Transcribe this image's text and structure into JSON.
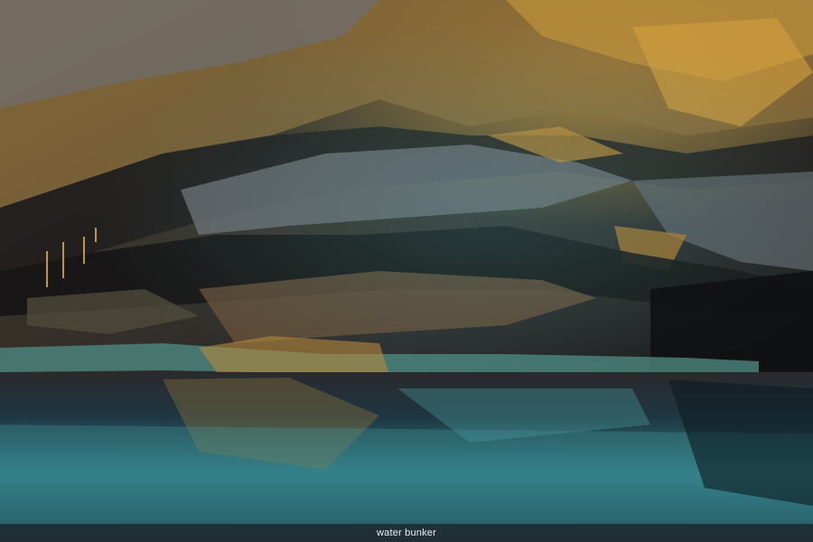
{
  "photo": {
    "subject": "cave-with-reflective-water",
    "colors": {
      "rock_dark": "#1c1a1a",
      "rock_gold": "#b98a2e",
      "rock_grey": "#5d6166",
      "water_teal": "#3f8f95",
      "water_deep": "#0f2a34"
    }
  },
  "caption": {
    "text": "water bunker"
  }
}
